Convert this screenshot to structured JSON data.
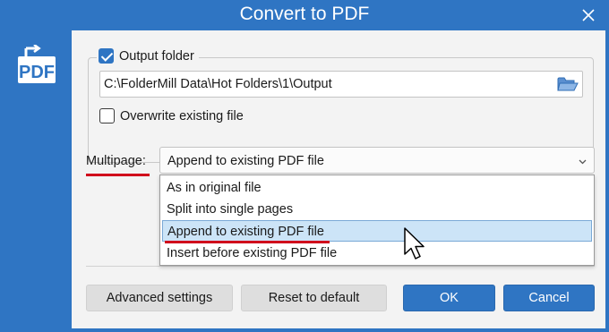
{
  "window": {
    "title": "Convert to PDF",
    "accent_color": "#2f75c3",
    "icons": {
      "close": "close-icon",
      "logo": "pdf-convert-logo-icon"
    }
  },
  "output_group": {
    "output_folder_label": "Output folder",
    "output_folder_checked": true,
    "path_value": "C:\\FolderMill Data\\Hot Folders\\1\\Output",
    "browse_icon": "folder-open-icon",
    "overwrite_label": "Overwrite existing file",
    "overwrite_checked": false
  },
  "multipage": {
    "label": "Multipage:",
    "selected_value": "Append to existing PDF file",
    "options": [
      "As in original file",
      "Split into single pages",
      "Append to existing PDF file",
      "Insert before existing PDF file"
    ],
    "highlighted_index": 2
  },
  "buttons": {
    "advanced": "Advanced settings",
    "reset": "Reset to default",
    "ok": "OK",
    "cancel": "Cancel"
  }
}
